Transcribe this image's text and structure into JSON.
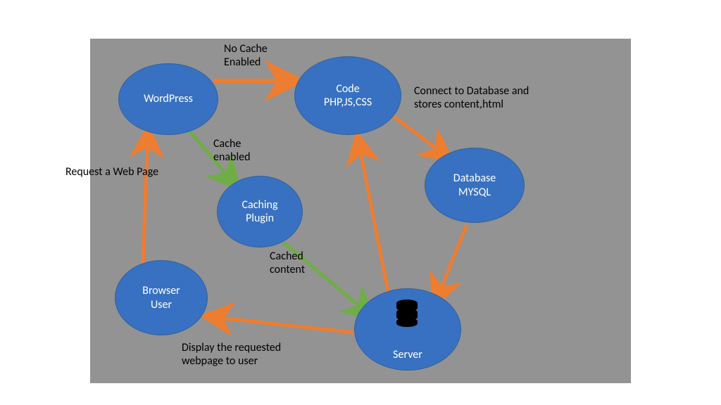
{
  "nodes": {
    "wordpress": {
      "label": "WordPress"
    },
    "code": {
      "label": "Code\nPHP,JS,CSS"
    },
    "database": {
      "label": "Database\nMYSQL"
    },
    "server": {
      "label": "Server"
    },
    "browser": {
      "label": "Browser\nUser"
    },
    "caching": {
      "label": "Caching\nPlugin"
    }
  },
  "edges": {
    "request_page": {
      "label": "Request a Web Page"
    },
    "no_cache": {
      "label": "No Cache\nEnabled"
    },
    "cache_enabled": {
      "label": "Cache\nenabled"
    },
    "connect_db": {
      "label": "Connect to Database and\nstores content,html"
    },
    "cached_content": {
      "label": "Cached\ncontent"
    },
    "display_page": {
      "label": "Display the requested\nwebpage to user"
    }
  },
  "colors": {
    "node_fill": "#3871c1",
    "arrow_orange": "#ed7d31",
    "arrow_green": "#70ad47",
    "canvas_bg": "#939393"
  }
}
